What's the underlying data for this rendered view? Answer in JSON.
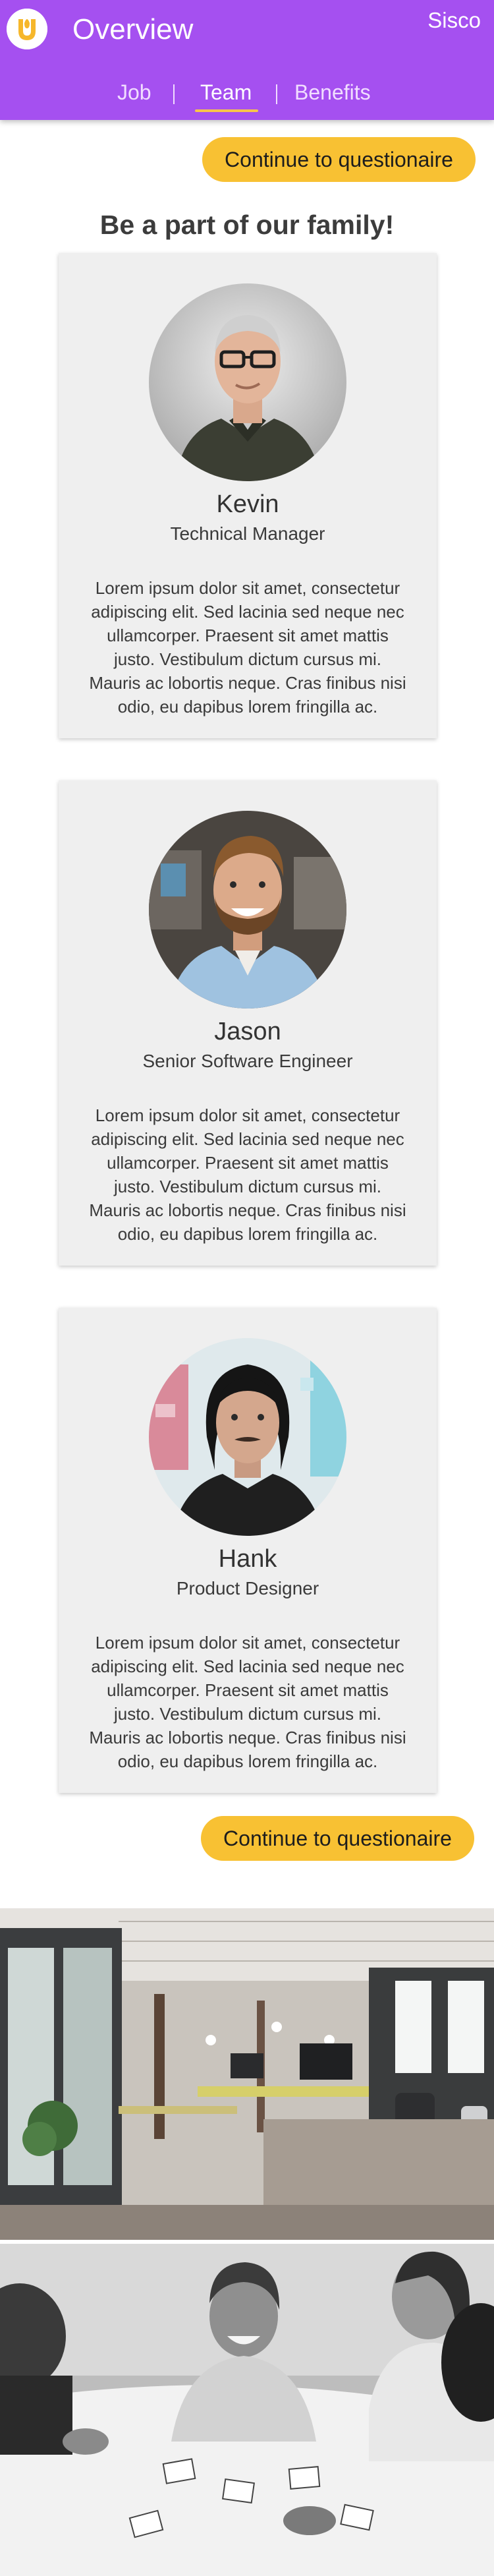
{
  "header": {
    "title": "Overview",
    "brand": "Sisco",
    "logo_icon": "yellow-u-logo-icon",
    "background_color": "#a550f0",
    "tabs": [
      {
        "label": "Job",
        "active": false
      },
      {
        "label": "Team",
        "active": true
      },
      {
        "label": "Benefits",
        "active": false
      }
    ]
  },
  "actions": {
    "continue_label": "Continue to questionaire",
    "button_color": "#f8c133"
  },
  "main": {
    "heading": "Be a part of our family!",
    "team": [
      {
        "name": "Kevin",
        "role": "Technical Manager",
        "bio": "Lorem ipsum dolor sit amet, consectetur adipiscing elit. Sed lacinia sed neque nec ullamcorper. Praesent sit amet mattis justo. Vestibulum dictum cursus mi. Mauris ac lobortis neque. Cras finibus nisi odio, eu dapibus lorem fringilla ac."
      },
      {
        "name": "Jason",
        "role": "Senior Software Engineer",
        "bio": "Lorem ipsum dolor sit amet, consectetur adipiscing elit. Sed lacinia sed neque nec ullamcorper. Praesent sit amet mattis justo. Vestibulum dictum cursus mi. Mauris ac lobortis neque. Cras finibus nisi odio, eu dapibus lorem fringilla ac."
      },
      {
        "name": "Hank",
        "role": "Product Designer",
        "bio": "Lorem ipsum dolor sit amet, consectetur adipiscing elit. Sed lacinia sed neque nec ullamcorper. Praesent sit amet mattis justo. Vestibulum dictum cursus mi. Mauris ac lobortis neque. Cras finibus nisi odio, eu dapibus lorem fringilla ac."
      }
    ]
  },
  "photos": [
    {
      "icon": "office-photo"
    },
    {
      "icon": "team-meeting-photo"
    }
  ]
}
